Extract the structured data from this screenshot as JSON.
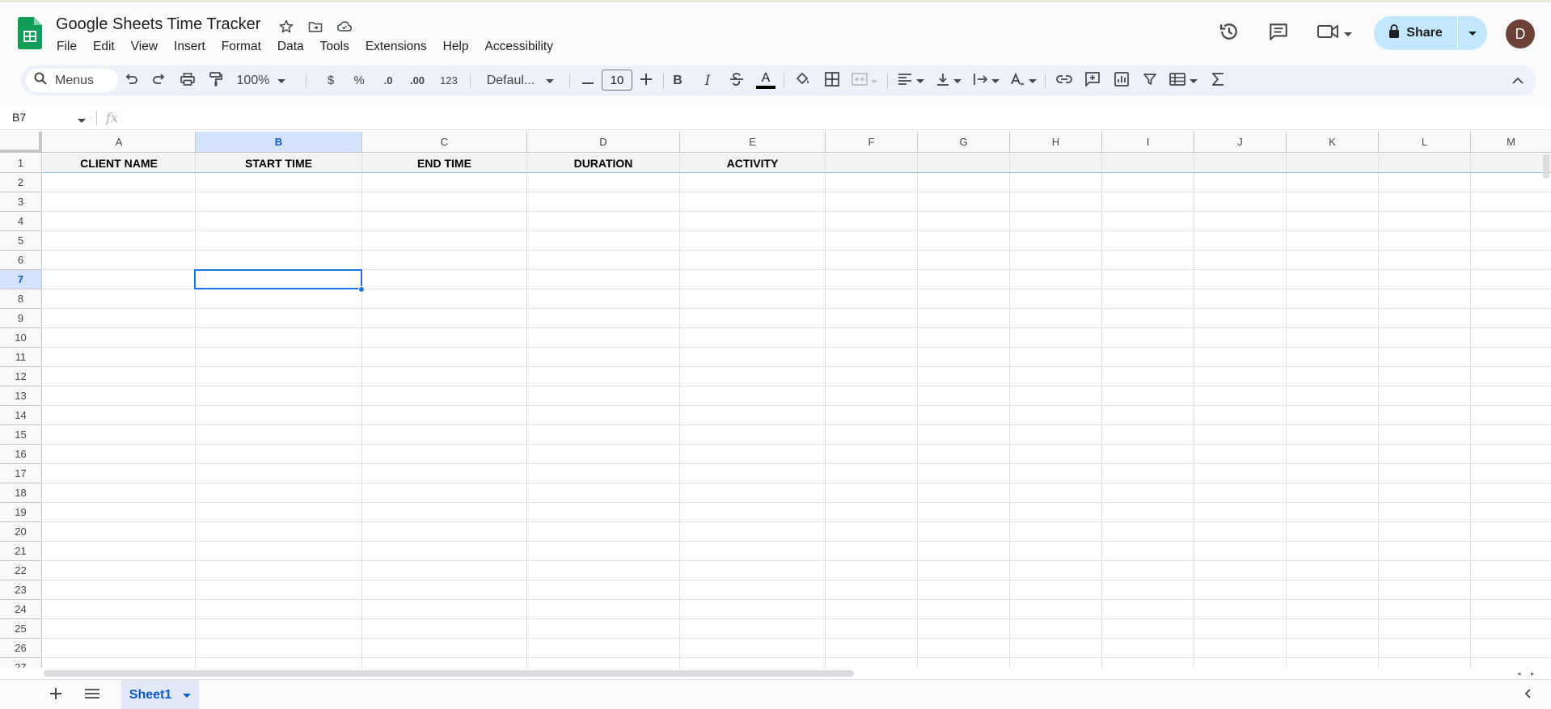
{
  "app": {
    "title": "Google Sheets Time Tracker",
    "menus": [
      "File",
      "Edit",
      "View",
      "Insert",
      "Format",
      "Data",
      "Tools",
      "Extensions",
      "Help",
      "Accessibility"
    ],
    "share_label": "Share",
    "avatar_letter": "D"
  },
  "toolbar": {
    "search_label": "Menus",
    "zoom": "100%",
    "currency": "$",
    "percent": "%",
    "decrease_decimal": ".0",
    "increase_decimal": ".00",
    "number_format": "123",
    "font": "Defaul...",
    "font_size": "10",
    "bold": "B",
    "italic": "I",
    "text_color_letter": "A"
  },
  "formula_bar": {
    "cell_ref": "B7",
    "fx": "fx",
    "value": ""
  },
  "sheet": {
    "columns": [
      "A",
      "B",
      "C",
      "D",
      "E",
      "F",
      "G",
      "H",
      "I",
      "J",
      "K",
      "L",
      "M"
    ],
    "selected_column": "B",
    "rows": [
      "1",
      "2",
      "3",
      "4",
      "5",
      "6",
      "7",
      "8",
      "9",
      "10",
      "11",
      "12",
      "13",
      "14",
      "15",
      "16",
      "17",
      "18",
      "19",
      "20",
      "21",
      "22",
      "23",
      "24",
      "25",
      "26",
      "27"
    ],
    "selected_row": "7",
    "headers": [
      "CLIENT NAME",
      "START TIME",
      "END TIME",
      "DURATION",
      "ACTIVITY"
    ],
    "selected_cell": "B7"
  },
  "tabs": {
    "active": "Sheet1"
  },
  "colors": {
    "accent": "#0b57d0",
    "selection": "#1a73e8",
    "share_bg": "#c2e7ff",
    "avatar_bg": "#6d4236",
    "sheets_green": "#0f9d58"
  }
}
